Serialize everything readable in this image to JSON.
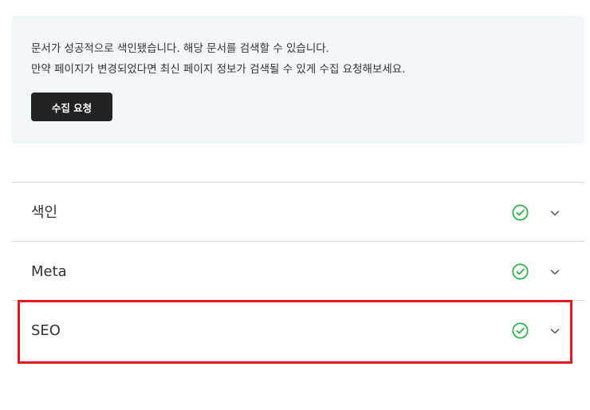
{
  "notice": {
    "line1": "문서가 성공적으로 색인됐습니다. 해당 문서를 검색할 수 있습니다.",
    "line2": "만약 페이지가 변경되었다면 최신 페이지 정보가 검색될 수 있게 수집 요청해보세요.",
    "request_button_label": "수집 요청"
  },
  "sections": [
    {
      "title": "색인",
      "status": "check-circle-icon",
      "status_color": "#2bb34a"
    },
    {
      "title": "Meta",
      "status": "check-circle-icon",
      "status_color": "#2bb34a"
    },
    {
      "title": "SEO",
      "status": "check-circle-icon",
      "status_color": "#2bb34a"
    }
  ],
  "colors": {
    "notice_bg": "#f2f8fa",
    "button_bg": "#222222",
    "success": "#2bb34a",
    "highlight": "#e3181f"
  }
}
